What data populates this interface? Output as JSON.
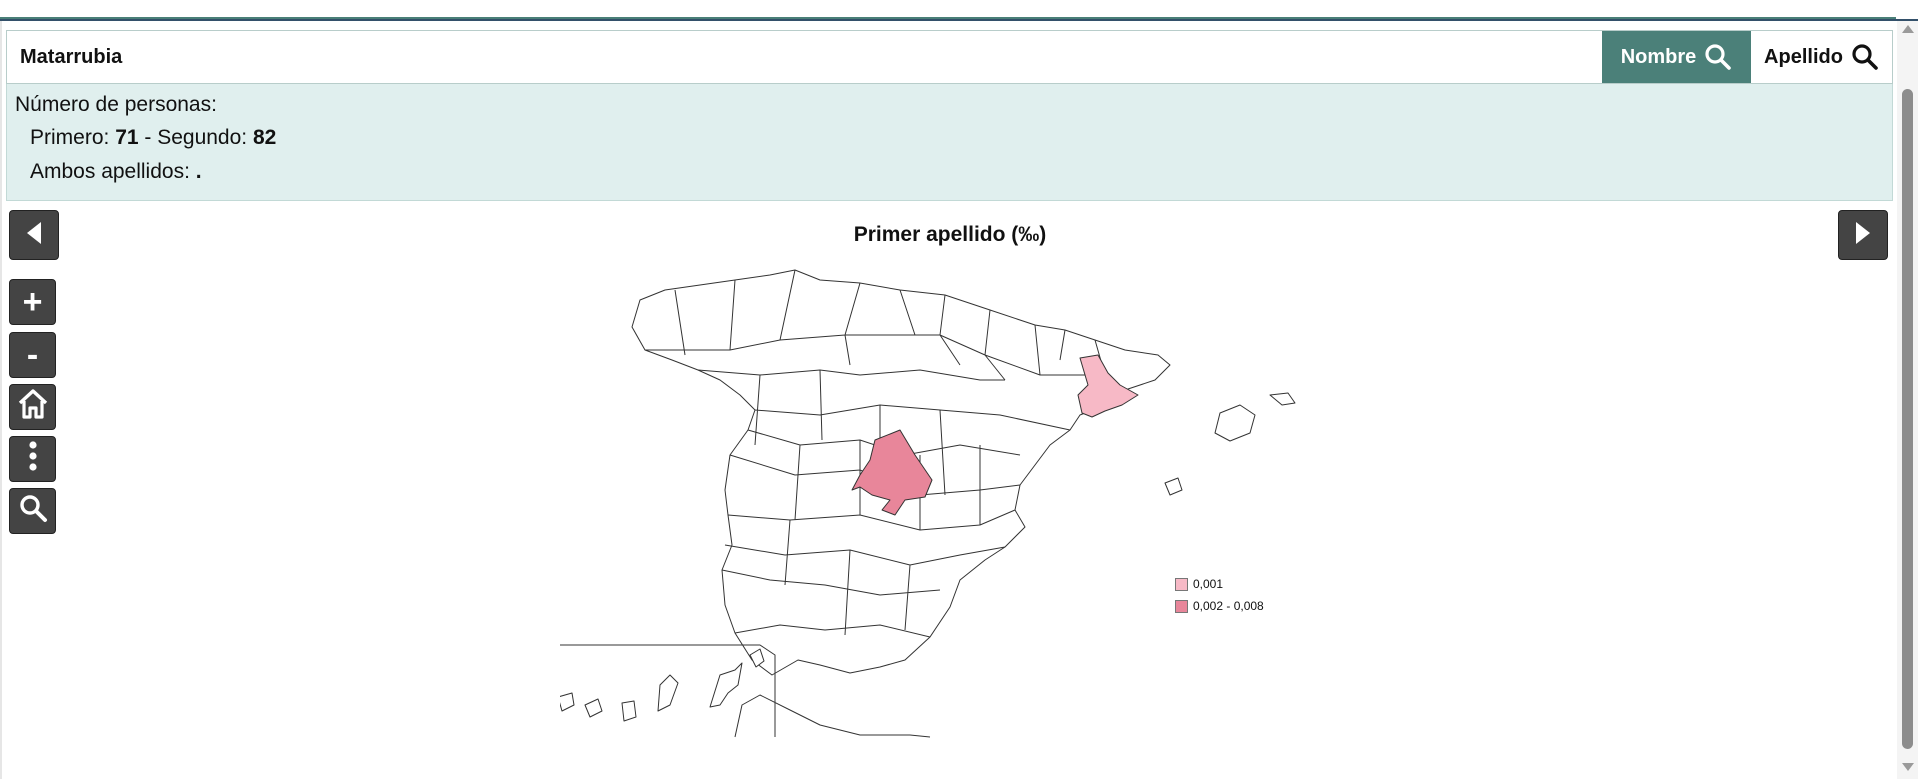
{
  "search": {
    "value": "Matarrubia",
    "nombre_label": "Nombre",
    "apellido_label": "Apellido"
  },
  "info": {
    "title": "Número de personas:",
    "first_label": "Primero: ",
    "first_value": "71",
    "separator": " - Segundo: ",
    "second_value": "82",
    "both_label": "Ambos apellidos: ",
    "both_value": "."
  },
  "map": {
    "title": "Primer apellido (‰)",
    "highlighted_regions": [
      {
        "name": "Barcelona",
        "color": "#f7b9c6"
      },
      {
        "name": "Madrid",
        "color": "#e8869a"
      }
    ],
    "legend": [
      {
        "label": "0,001",
        "color": "#f7b9c6"
      },
      {
        "label": "0,002 - 0,008",
        "color": "#e8869a"
      }
    ]
  },
  "tools": {
    "zoom_in": "+",
    "zoom_out": "-"
  },
  "colors": {
    "accent": "#4b8079",
    "panel": "#e0efee",
    "tool_bg": "#444444"
  }
}
